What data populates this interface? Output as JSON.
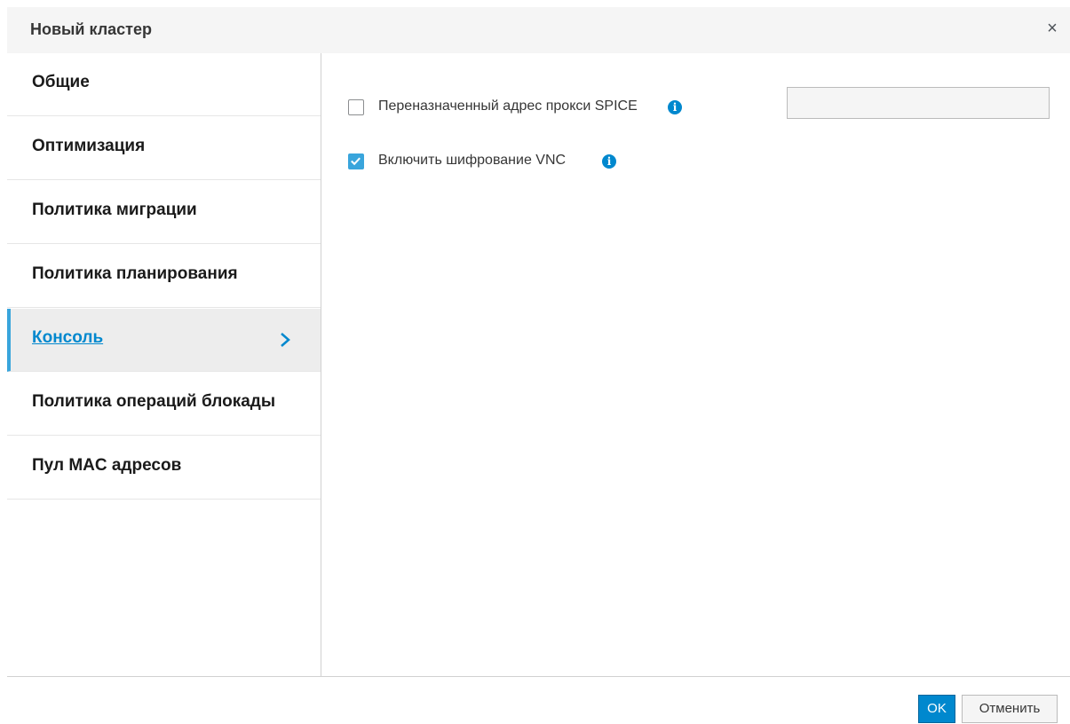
{
  "dialog": {
    "title": "Новый кластер",
    "close_label": "×"
  },
  "sidebar": {
    "items": [
      {
        "label": "Общие",
        "active": false
      },
      {
        "label": "Оптимизация",
        "active": false
      },
      {
        "label": "Политика миграции",
        "active": false
      },
      {
        "label": "Политика планирования",
        "active": false
      },
      {
        "label": "Консоль",
        "active": true
      },
      {
        "label": "Политика операций блокады",
        "active": false
      },
      {
        "label": "Пул MAC адресов",
        "active": false
      }
    ]
  },
  "content": {
    "spice_proxy": {
      "label": "Переназначенный адрес прокси SPICE",
      "checked": false,
      "value": ""
    },
    "vnc_encryption": {
      "label": "Включить шифрование VNC",
      "checked": true
    },
    "info_icon": "info-icon"
  },
  "footer": {
    "ok_label": "OK",
    "cancel_label": "Отменить"
  },
  "colors": {
    "accent": "#0088ce",
    "active_border": "#39a5dc",
    "header_bg": "#f5f5f5"
  }
}
